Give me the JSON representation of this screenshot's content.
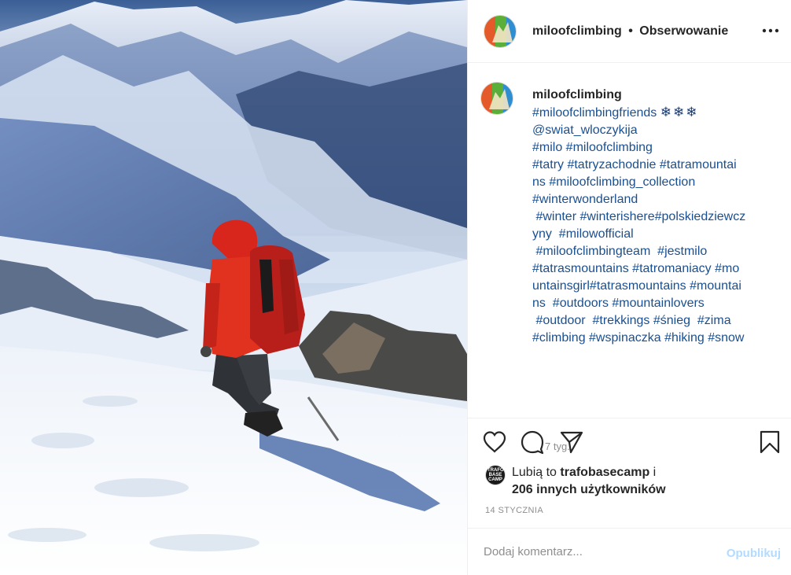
{
  "header": {
    "username": "miloofclimbing",
    "separator": "•",
    "follow_label": "Obserwowanie"
  },
  "caption": {
    "username": "miloofclimbing",
    "lines": [
      "#miloofclimbingfriends",
      "@swiat_wloczykija",
      "#milo #miloofclimbing",
      "#tatry #tatryzachodnie #tatramountai",
      "ns #miloofclimbing_collection",
      "#winterwonderland",
      " #winter #winterishere#polskiedziewcz",
      "yny  #milowofficial",
      " #miloofclimbingteam  #jestmilo",
      "#tatrasmountains #tatromaniacy #mo",
      "untainsgirl#tatrasmountains #mountai",
      "ns  #outdoors #mountainlovers",
      " #outdoor  #trekkings #śnieg  #zima",
      "#climbing #wspinaczka #hiking #snow"
    ],
    "snowflakes": "❄❄❄",
    "time_ago": "7 tyg."
  },
  "likes": {
    "avatar_text": "TRAFO BASE CAMP",
    "prefix": "Lubią to",
    "user": "trafobasecamp",
    "conjunction": "i",
    "others": "206 innych użytkowników"
  },
  "date": "14 STYCZNIA",
  "comment": {
    "placeholder": "Dodaj komentarz...",
    "publish_label": "Opublikuj"
  },
  "colors": {
    "hashtag": "#1a4f8f",
    "publish_disabled": "#b3dbff",
    "jacket": "#d8261c",
    "sky": "#6d8fc0"
  }
}
